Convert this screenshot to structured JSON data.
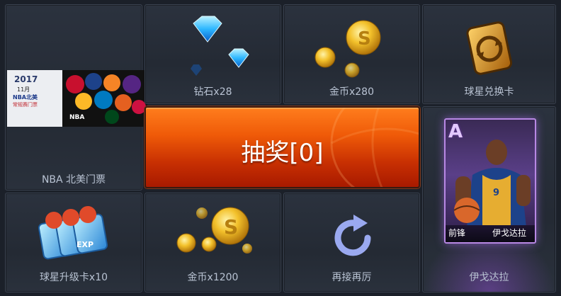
{
  "tiles": {
    "nba_ticket": {
      "label": "NBA 北美门票",
      "ticket_year": "2017",
      "ticket_month": "11月",
      "ticket_line1": "NBA北美",
      "ticket_line2": "常规赛门票",
      "ticket_brand": "NBA"
    },
    "diamonds": {
      "label": "钻石x28"
    },
    "coins_280": {
      "label": "金币x280"
    },
    "star_exchange_card": {
      "label": "球星兑换卡"
    },
    "star_upgrade_card": {
      "label": "球星升级卡x10",
      "badge_text": "EXP"
    },
    "coins_1200": {
      "label": "金币x1200"
    },
    "retry": {
      "label": "再接再厉"
    },
    "player": {
      "label": "伊戈达拉",
      "card_grade": "A",
      "card_position": "前锋",
      "card_name": "伊戈达拉",
      "jersey_number": "9"
    }
  },
  "draw_button": {
    "label": "抽奖[0]"
  },
  "colors": {
    "tile_border": "#3a4250",
    "label_text": "#b9c3d3",
    "draw_orange": "#ef5a08",
    "card_purple": "#b888e4"
  }
}
